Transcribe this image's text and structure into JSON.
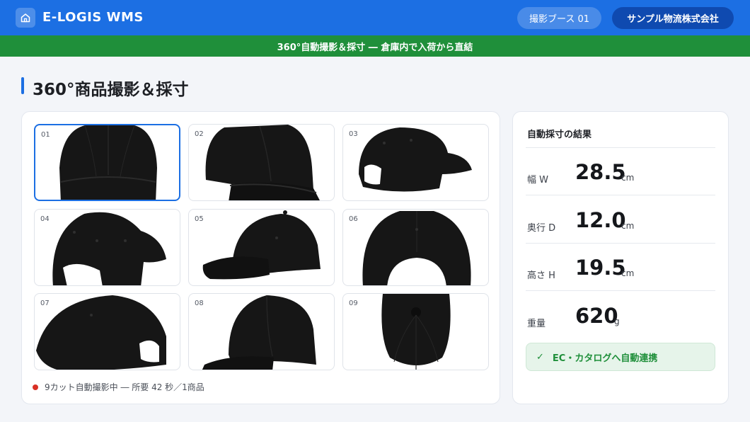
{
  "header": {
    "title": "E-LOGIS WMS",
    "booth": "撮影ブース 01",
    "company": "サンプル物流株式会社"
  },
  "banner": {
    "text": "360°自動撮影＆採寸 ― 倉庫内で入荷から直結"
  },
  "page": {
    "title": "360°商品撮影＆採寸"
  },
  "gallery": {
    "selected": "01",
    "thumbnails": [
      {
        "num": "01",
        "view": "front"
      },
      {
        "num": "02",
        "view": "front-right"
      },
      {
        "num": "03",
        "view": "back-right"
      },
      {
        "num": "04",
        "view": "back-left"
      },
      {
        "num": "05",
        "view": "left-side"
      },
      {
        "num": "06",
        "view": "back"
      },
      {
        "num": "07",
        "view": "rear-left"
      },
      {
        "num": "08",
        "view": "front-left"
      },
      {
        "num": "09",
        "view": "top"
      }
    ],
    "status": "9カット自動撮影中 ― 所要 42 秒／1商品"
  },
  "results": {
    "title": "自動採寸の結果",
    "metrics": [
      {
        "label": "幅 W",
        "value": "28.5",
        "unit": "cm"
      },
      {
        "label": "奥行 D",
        "value": "12.0",
        "unit": "cm"
      },
      {
        "label": "高さ H",
        "value": "19.5",
        "unit": "cm"
      },
      {
        "label": "重量",
        "value": "620",
        "unit": "g"
      }
    ],
    "ec_link": "EC・カタログへ自動連携"
  },
  "colors": {
    "primary": "#1c6fe3",
    "banner_green": "#1f8f3a",
    "status_red": "#d93025",
    "cap_black": "#161616"
  },
  "icons": {
    "home": "home-icon",
    "check": "check-icon",
    "status": "status-dot"
  }
}
